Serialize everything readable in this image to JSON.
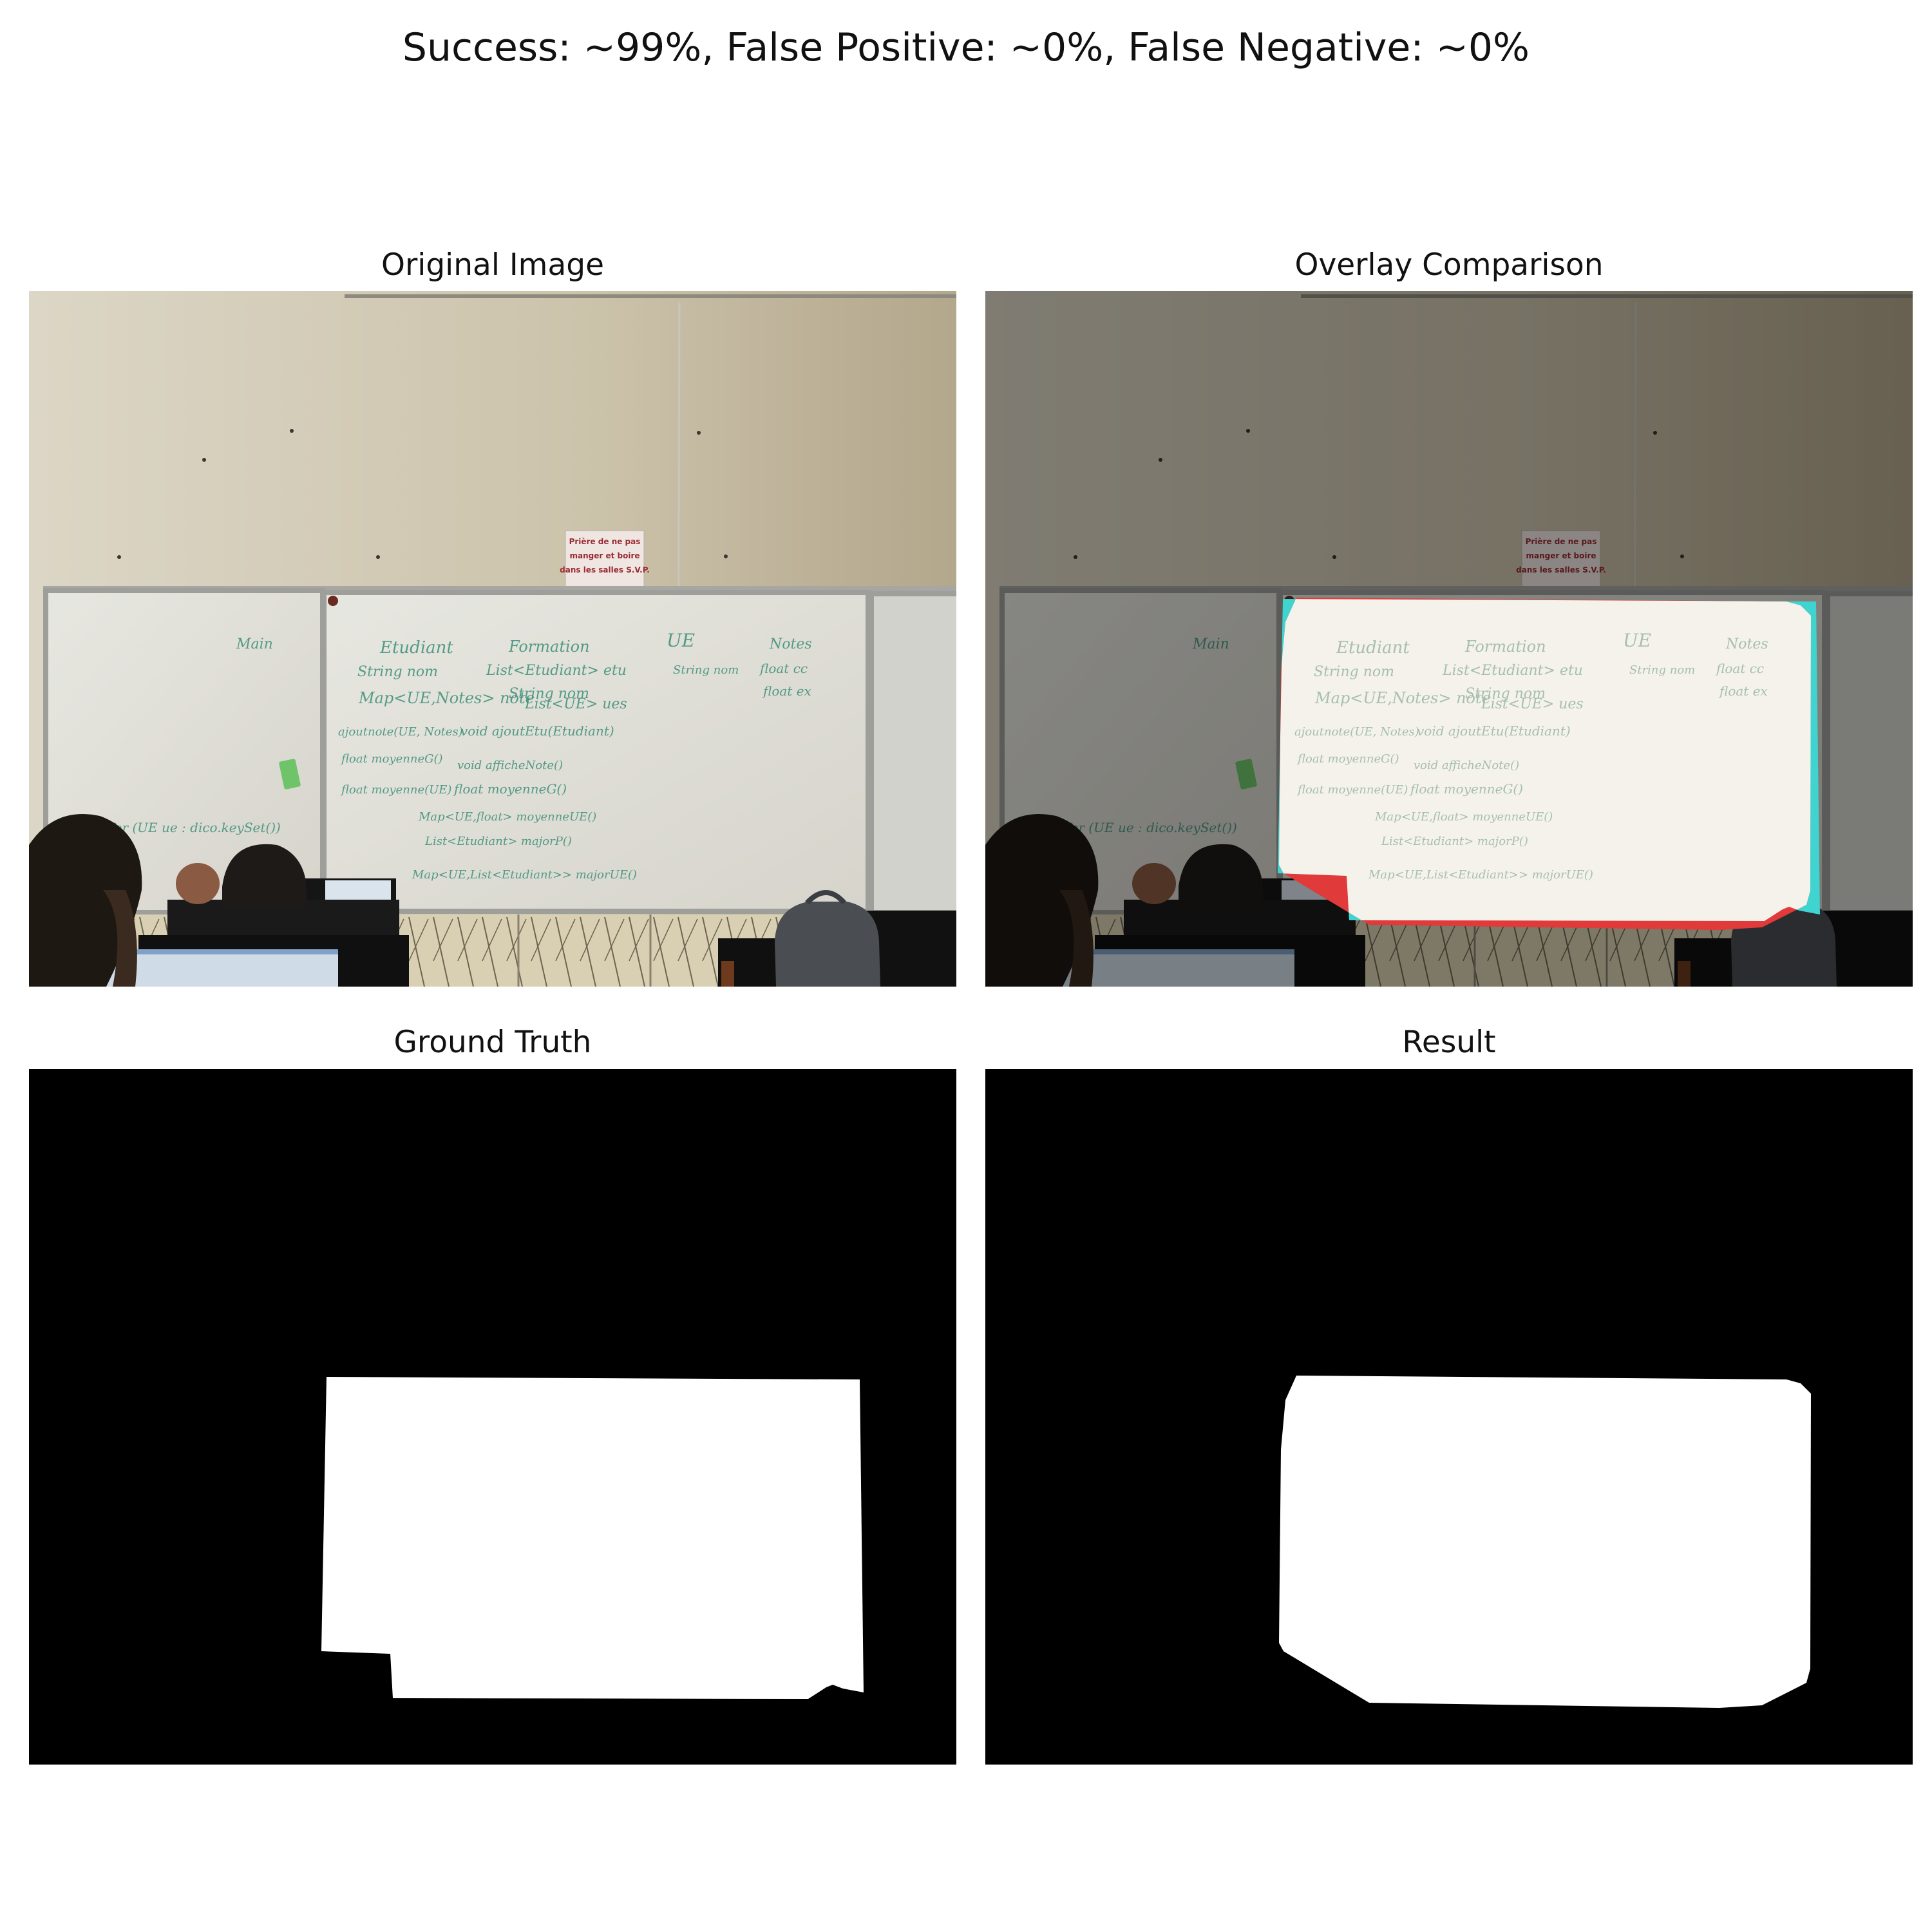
{
  "figure": {
    "title": "Success: ~99%, False Positive: ~0%, False Negative: ~0%"
  },
  "panels": {
    "original": {
      "title": "Original Image"
    },
    "overlay": {
      "title": "Overlay Comparison"
    },
    "ground_truth": {
      "title": "Ground Truth"
    },
    "result": {
      "title": "Result"
    }
  },
  "scene": {
    "sign_text": [
      "Prière de ne pas",
      "manger et boire",
      "dans les salles S.V.P."
    ],
    "board_text": [
      "Main",
      "Etudiant",
      "Formation",
      "UE",
      "Notes",
      "String nom",
      "List<Etudiant> etu",
      "String nom",
      "float cc",
      "float ex",
      "String nom",
      "Map<UE,Notes> note",
      "List<UE> ues",
      "ajoutnote(UE, Notes)",
      "void ajoutEtu(Etudiant)",
      "float moyenneG()",
      "void afficheNote()",
      "float moyenne(UE)",
      "float moyenneG()",
      "Map<UE,float> moyenneUE()",
      "List<Etudiant> majorP()",
      "Map<UE,List<Etudiant>> majorUE()",
      "for (UE ue : dico.keySet())"
    ]
  },
  "colors": {
    "background": "#ffffff",
    "mask_fill": "#ffffff",
    "mask_bg": "#000000",
    "false_negative": "#3fd4d0",
    "false_positive": "#e03a3a",
    "marker_ink": "#3b8f78"
  }
}
